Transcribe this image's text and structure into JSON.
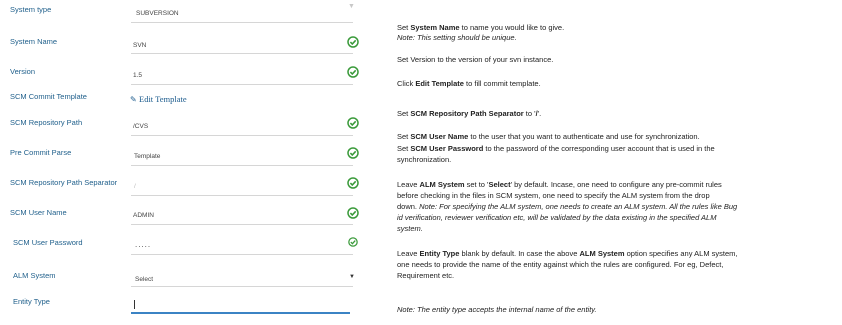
{
  "form": {
    "system_type": {
      "label": "System type",
      "value": "SUBVERSION"
    },
    "system_name": {
      "label": "System Name",
      "value": "SVN"
    },
    "version": {
      "label": "Version",
      "value": "1.5"
    },
    "commit_template": {
      "label": "SCM Commit Template",
      "link": "Edit Template"
    },
    "repo_path": {
      "label": "SCM Repository Path",
      "value": "/CVS"
    },
    "pre_commit": {
      "label": "Pre Commit Parse",
      "value": "Template"
    },
    "path_separator": {
      "label": "SCM Repository Path Separator",
      "value": "/"
    },
    "user_name": {
      "label": "SCM User Name",
      "value": "ADMIN"
    },
    "user_password": {
      "label": "SCM User Password",
      "value": "....."
    },
    "alm_system": {
      "label": "ALM System",
      "value": "Select"
    },
    "entity_type": {
      "label": "Entity Type",
      "value": ""
    }
  },
  "help": {
    "h1": {
      "a": "Set ",
      "b": "System Name",
      "c": " to name you would like to give."
    },
    "h1_note": "Note: This setting should be unique.",
    "h2": "Set Version to the version of your svn instance.",
    "h3": {
      "a": "Click ",
      "b": "Edit Template",
      "c": " to fill commit template."
    },
    "h4": {
      "a": "Set ",
      "b": "SCM Repository Path Separator",
      "c": " to '",
      "d": "/",
      "e": "'."
    },
    "h5a": {
      "a": "Set ",
      "b": "SCM User Name",
      "c": " to the user that you want to authenticate and use for synchronization."
    },
    "h5b": {
      "a": "Set ",
      "b": "SCM User Password",
      "c": " to the password of the corresponding user account that is used in the"
    },
    "h5c": "synchronization.",
    "h6a": {
      "a": "Leave ",
      "b": "ALM System",
      "c": " set to '",
      "d": "Select",
      "e": "' by default. Incase, one need to configure any pre-commit rules"
    },
    "h6b": "before checking in the files in SCM system, one need to specify the ALM system from the drop",
    "h6c": {
      "a": "down. ",
      "b": "Note: For specifying the ALM system, one needs to create an ALM system. All the rules like Bug"
    },
    "h6d": "id verification, reviewer verification etc, will be validated by the data existing in the specified ALM",
    "h6e": "system.",
    "h7a": {
      "a": "Leave ",
      "b": "Entity Type",
      "c": " blank by default. In case the above ",
      "d": "ALM System",
      "e": " option specifies any ALM system,"
    },
    "h7b": "one needs to provide the name of the entity against which the rules are configured. For eg, Defect,",
    "h7c": "Requirement etc.",
    "h8": "Note: The entity type accepts the internal name of the entity."
  },
  "colors": {
    "label": "#1f5f8b",
    "check": "#3a9a3a",
    "active_line": "#3b83c4"
  },
  "icons": {
    "check": "check-circle-icon",
    "edit": "pencil-icon",
    "dropdown": "caret-down-icon"
  }
}
